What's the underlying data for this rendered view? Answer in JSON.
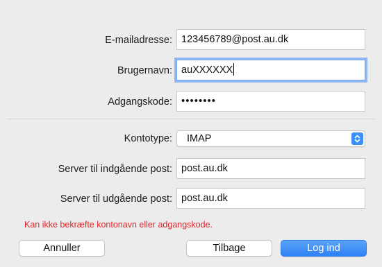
{
  "form": {
    "email": {
      "label": "E-mailadresse:",
      "value": "123456789@post.au.dk"
    },
    "username": {
      "label": "Brugernavn:",
      "value": "auXXXXXX"
    },
    "password": {
      "label": "Adgangskode:",
      "value": "••••••••"
    },
    "account_type": {
      "label": "Kontotype:",
      "value": "IMAP"
    },
    "incoming_server": {
      "label": "Server til indgående post:",
      "value": "post.au.dk"
    },
    "outgoing_server": {
      "label": "Server til udgående post:",
      "value": "post.au.dk"
    }
  },
  "error_message": "Kan ikke bekræfte kontonavn eller adgangskode.",
  "buttons": {
    "cancel": "Annuller",
    "back": "Tilbage",
    "login": "Log ind"
  },
  "colors": {
    "error": "#e0252a",
    "accent": "#3b8ff6",
    "focus_ring": "#8fb8f2"
  }
}
